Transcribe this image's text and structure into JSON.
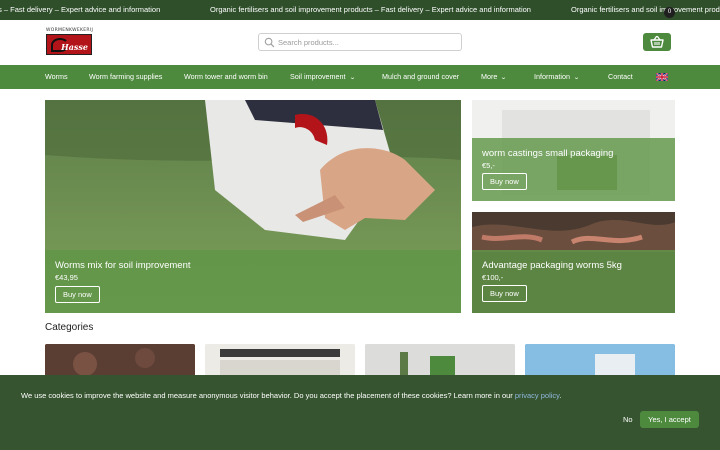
{
  "ticker": {
    "items": [
      "ts – Fast delivery – Expert advice and information",
      "Organic fertilisers and soil improvement products – Fast delivery – Expert advice and information",
      "Organic fertilisers and soil improvement products"
    ]
  },
  "header": {
    "logo_text": "WORMENKWEKERIJ",
    "logo_script": "Hasse",
    "search_placeholder": "Search products...",
    "cart_count": "0"
  },
  "nav": {
    "items": [
      {
        "label": "Worms"
      },
      {
        "label": "Worm farming supplies"
      },
      {
        "label": "Worm tower and worm bin"
      },
      {
        "label": "Soil improvement"
      },
      {
        "label": "Mulch and ground cover"
      },
      {
        "label": "More"
      },
      {
        "label": "Information"
      },
      {
        "label": "Contact"
      }
    ],
    "chevron": "⌄"
  },
  "featured": [
    {
      "title": "Worms mix for soil improvement",
      "price": "€43,95",
      "button": "Buy now"
    },
    {
      "title": "worm castings small packaging",
      "price": "€5,-",
      "button": "Buy now"
    },
    {
      "title": "Advantage packaging worms 5kg",
      "price": "€100,-",
      "button": "Buy now"
    }
  ],
  "categories": {
    "title": "Categories"
  },
  "cookie": {
    "message": "We use cookies to improve the website and measure anonymous visitor behavior. Do you accept the placement of these cookies? Learn more in our ",
    "link": "privacy policy",
    "period": ".",
    "no": "No",
    "yes": "Yes, I accept"
  },
  "colors": {
    "brand_green": "#4e8a3e",
    "ticker_bg": "#2f4f2b",
    "cookie_bg": "#36542f"
  }
}
